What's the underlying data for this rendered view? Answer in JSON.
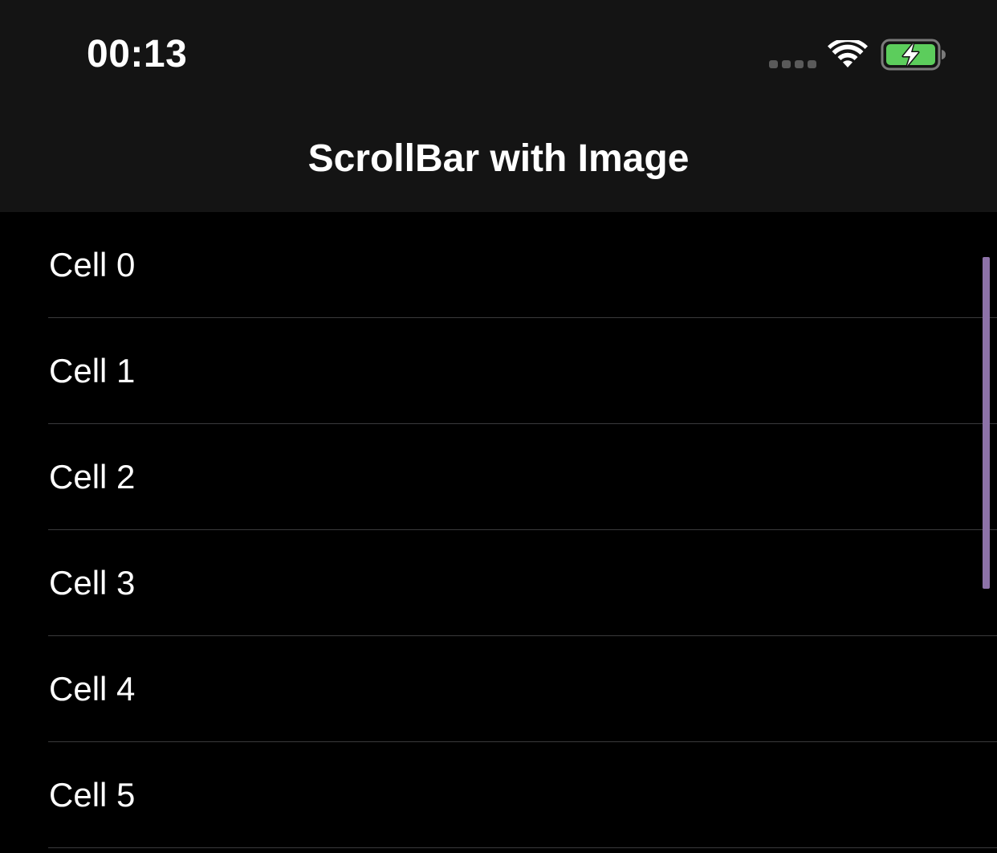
{
  "status_bar": {
    "time": "00:13",
    "signal_icon": "cellular-signal-dots",
    "wifi_icon": "wifi-icon",
    "battery_icon": "battery-charging-icon",
    "battery_color": "#5ccd5c"
  },
  "nav_bar": {
    "title": "ScrollBar with Image"
  },
  "table": {
    "cells": [
      {
        "label": "Cell 0"
      },
      {
        "label": "Cell 1"
      },
      {
        "label": "Cell 2"
      },
      {
        "label": "Cell 3"
      },
      {
        "label": "Cell 4"
      },
      {
        "label": "Cell 5"
      }
    ]
  },
  "scroll_indicator": {
    "color": "#8d72a8"
  },
  "colors": {
    "header_background": "#141414",
    "content_background": "#000000",
    "separator": "#3a3a3c",
    "text": "#ffffff"
  }
}
